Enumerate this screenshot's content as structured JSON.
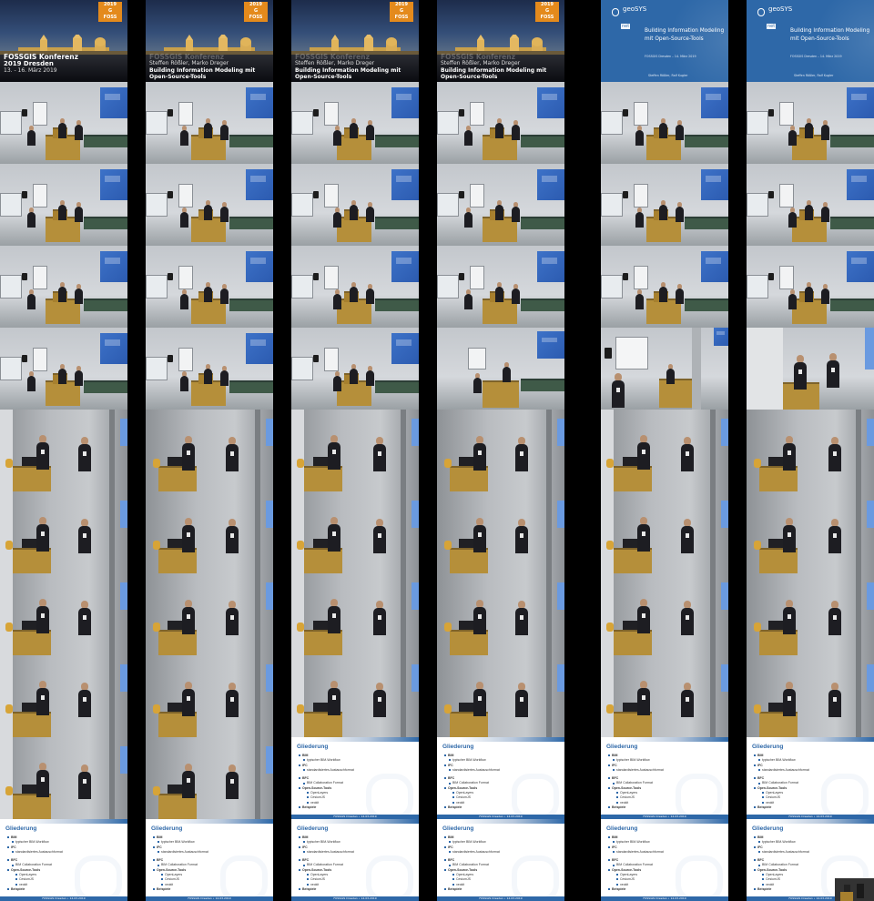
{
  "sheet": {
    "title_frame": {
      "logo": [
        "2019",
        "G",
        "FOSS"
      ],
      "line1": "FOSSGIS Konferenz",
      "line2": "2019 Dresden",
      "line3": "13. - 16. März 2019",
      "speakers": "Steffen Rößler, Marko Dreger",
      "talk_title": "Building Information Modeling mit Open-Source-Tools"
    },
    "blue_slide": {
      "brand": "geoSYS",
      "net": "net",
      "title": "Building Information Modeling mit Open-Source-Tools",
      "subtitle": "FOSSGIS Dresden – 14. März 2019",
      "authors": "Steffen Rößler, Ralf Kugler"
    },
    "agenda_slide": {
      "heading": "Gliederung",
      "items": [
        {
          "level": 1,
          "text": "BIM"
        },
        {
          "level": 2,
          "text": "typischer BIM-Workflow"
        },
        {
          "level": 1,
          "text": "IFC"
        },
        {
          "level": 2,
          "text": "standardisiertes Austauschformat"
        },
        {
          "level": 1,
          "text": "BFC",
          "gap": true
        },
        {
          "level": 2,
          "text": "BIM Collaboration Format"
        },
        {
          "level": 1,
          "text": "Open-Source-Tools"
        },
        {
          "level": 3,
          "text": "OpenLayers"
        },
        {
          "level": 3,
          "text": "CesiumJS"
        },
        {
          "level": 3,
          "text": "xeokit"
        },
        {
          "level": 1,
          "text": "Beispiele"
        }
      ],
      "footer": "FOSSGIS Dresden • 14.03.2019"
    },
    "columns": 6,
    "rows": 11,
    "frame_types": [
      [
        "title",
        "title-speakers",
        "title-speakers",
        "title-speakers",
        "blue",
        "blue"
      ],
      [
        "room-a",
        "room-a",
        "room-a",
        "room-a",
        "room-a",
        "room-a"
      ],
      [
        "room-a",
        "room-a",
        "room-a",
        "room-a",
        "room-a",
        "room-a"
      ],
      [
        "room-a",
        "room-a",
        "room-a",
        "room-a",
        "room-a",
        "room-a"
      ],
      [
        "room-a",
        "room-a",
        "room-a",
        "room-b",
        "room-c",
        "room-d"
      ],
      [
        "close",
        "close",
        "close",
        "close",
        "close",
        "close"
      ],
      [
        "close",
        "close",
        "close",
        "close",
        "close",
        "close"
      ],
      [
        "close",
        "close",
        "close",
        "close",
        "close",
        "close"
      ],
      [
        "close",
        "close",
        "close",
        "close",
        "close",
        "close"
      ],
      [
        "close",
        "close",
        "agenda",
        "agenda",
        "agenda",
        "agenda"
      ],
      [
        "agenda",
        "agenda",
        "agenda",
        "agenda",
        "agenda",
        "agenda"
      ]
    ],
    "has_trailing_small_frame": true
  }
}
